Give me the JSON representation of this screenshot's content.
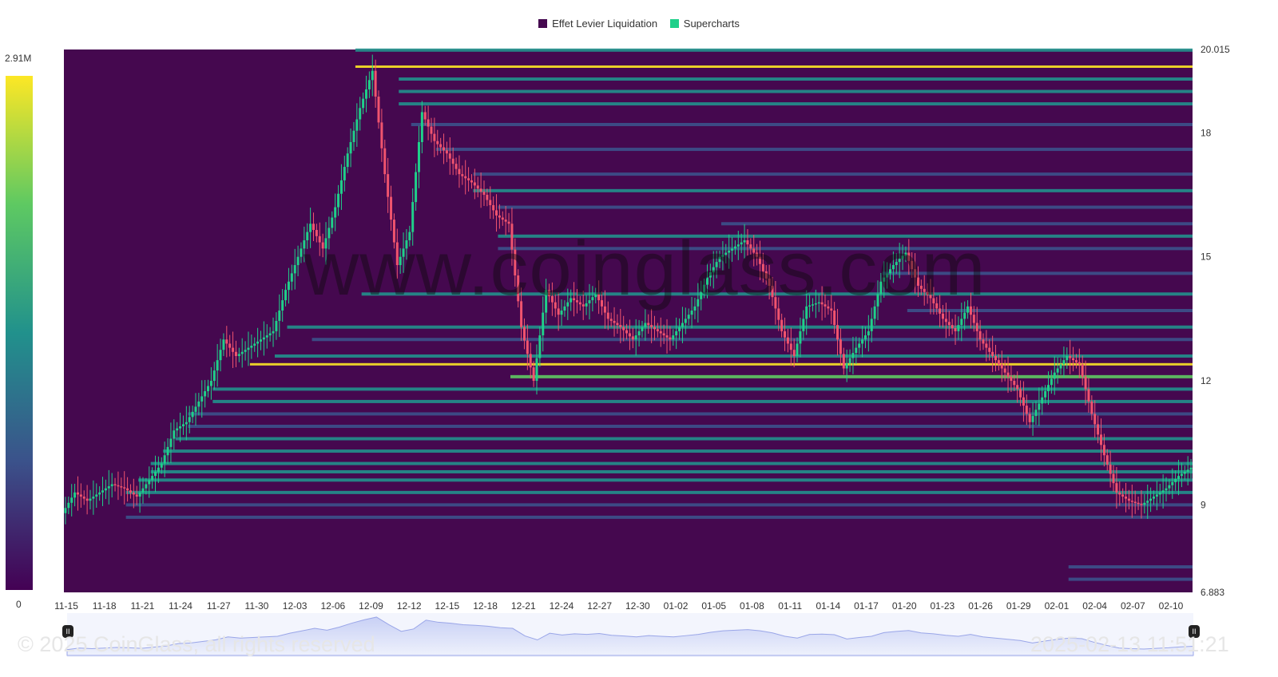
{
  "legend": {
    "items": [
      {
        "label": "Effet Levier Liquidation",
        "color": "#45084f"
      },
      {
        "label": "Supercharts",
        "color": "#1fd08a"
      }
    ]
  },
  "colorbar": {
    "max_label": "2.91M",
    "min_label": "0"
  },
  "watermark": "www.coinglass.com",
  "footer": {
    "copyright": "© 2025 CoinGlass, all rights reserved",
    "timestamp": "2025-02-13 11:51:21"
  },
  "slider": {
    "left_handle": "II",
    "right_handle": "II"
  },
  "colors": {
    "background": "#45084f",
    "low": "#3b528b",
    "mid": "#21918c",
    "high": "#5ec962",
    "max": "#fde725",
    "up": "#1fd08a",
    "down": "#f0546e"
  },
  "chart_data": {
    "type": "heatmap",
    "title": "",
    "xlabel": "",
    "ylabel": "",
    "x_ticks": [
      "11-15",
      "11-18",
      "11-21",
      "11-24",
      "11-27",
      "11-30",
      "12-03",
      "12-06",
      "12-09",
      "12-12",
      "12-15",
      "12-18",
      "12-21",
      "12-24",
      "12-27",
      "12-30",
      "01-02",
      "01-05",
      "01-08",
      "01-11",
      "01-14",
      "01-17",
      "01-20",
      "01-23",
      "01-26",
      "01-29",
      "02-01",
      "02-04",
      "02-07",
      "02-10"
    ],
    "y_ticks": [
      "20.015",
      "18",
      "15",
      "12",
      "9",
      "6.883"
    ],
    "ylim": [
      6.883,
      20.015
    ],
    "xlim": [
      0,
      91
    ],
    "price_series": [
      {
        "x": 0,
        "y": 8.8
      },
      {
        "x": 1,
        "y": 9.3
      },
      {
        "x": 2,
        "y": 9.1
      },
      {
        "x": 3,
        "y": 9.3
      },
      {
        "x": 4,
        "y": 9.5
      },
      {
        "x": 5,
        "y": 9.4
      },
      {
        "x": 6,
        "y": 9.2
      },
      {
        "x": 7,
        "y": 9.6
      },
      {
        "x": 8,
        "y": 10.0
      },
      {
        "x": 9,
        "y": 10.8
      },
      {
        "x": 10,
        "y": 11.0
      },
      {
        "x": 11,
        "y": 11.5
      },
      {
        "x": 12,
        "y": 12.0
      },
      {
        "x": 13,
        "y": 13.0
      },
      {
        "x": 14,
        "y": 12.6
      },
      {
        "x": 15,
        "y": 12.8
      },
      {
        "x": 16,
        "y": 13.0
      },
      {
        "x": 17,
        "y": 13.2
      },
      {
        "x": 18,
        "y": 14.2
      },
      {
        "x": 19,
        "y": 15.0
      },
      {
        "x": 20,
        "y": 15.8
      },
      {
        "x": 21,
        "y": 15.2
      },
      {
        "x": 22,
        "y": 16.2
      },
      {
        "x": 23,
        "y": 17.5
      },
      {
        "x": 24,
        "y": 18.6
      },
      {
        "x": 25,
        "y": 19.5
      },
      {
        "x": 26,
        "y": 17.0
      },
      {
        "x": 27,
        "y": 14.8
      },
      {
        "x": 28,
        "y": 15.6
      },
      {
        "x": 29,
        "y": 18.5
      },
      {
        "x": 30,
        "y": 17.8
      },
      {
        "x": 31,
        "y": 17.5
      },
      {
        "x": 32,
        "y": 17.0
      },
      {
        "x": 33,
        "y": 16.8
      },
      {
        "x": 34,
        "y": 16.5
      },
      {
        "x": 35,
        "y": 16.0
      },
      {
        "x": 36,
        "y": 15.8
      },
      {
        "x": 37,
        "y": 13.3
      },
      {
        "x": 38,
        "y": 12.0
      },
      {
        "x": 39,
        "y": 14.2
      },
      {
        "x": 40,
        "y": 13.6
      },
      {
        "x": 41,
        "y": 14.0
      },
      {
        "x": 42,
        "y": 13.8
      },
      {
        "x": 43,
        "y": 14.1
      },
      {
        "x": 44,
        "y": 13.5
      },
      {
        "x": 45,
        "y": 13.3
      },
      {
        "x": 46,
        "y": 13.0
      },
      {
        "x": 47,
        "y": 13.4
      },
      {
        "x": 48,
        "y": 13.2
      },
      {
        "x": 49,
        "y": 13.0
      },
      {
        "x": 50,
        "y": 13.4
      },
      {
        "x": 51,
        "y": 13.8
      },
      {
        "x": 52,
        "y": 14.5
      },
      {
        "x": 53,
        "y": 15.0
      },
      {
        "x": 54,
        "y": 15.2
      },
      {
        "x": 55,
        "y": 15.4
      },
      {
        "x": 56,
        "y": 15.0
      },
      {
        "x": 57,
        "y": 14.3
      },
      {
        "x": 58,
        "y": 13.2
      },
      {
        "x": 59,
        "y": 12.6
      },
      {
        "x": 60,
        "y": 13.8
      },
      {
        "x": 61,
        "y": 13.9
      },
      {
        "x": 62,
        "y": 13.7
      },
      {
        "x": 63,
        "y": 12.3
      },
      {
        "x": 64,
        "y": 12.8
      },
      {
        "x": 65,
        "y": 13.2
      },
      {
        "x": 66,
        "y": 14.4
      },
      {
        "x": 67,
        "y": 14.8
      },
      {
        "x": 68,
        "y": 15.1
      },
      {
        "x": 69,
        "y": 14.3
      },
      {
        "x": 70,
        "y": 14.0
      },
      {
        "x": 71,
        "y": 13.5
      },
      {
        "x": 72,
        "y": 13.2
      },
      {
        "x": 73,
        "y": 13.8
      },
      {
        "x": 74,
        "y": 13.0
      },
      {
        "x": 75,
        "y": 12.6
      },
      {
        "x": 76,
        "y": 12.2
      },
      {
        "x": 77,
        "y": 11.8
      },
      {
        "x": 78,
        "y": 11.0
      },
      {
        "x": 79,
        "y": 11.6
      },
      {
        "x": 80,
        "y": 12.2
      },
      {
        "x": 81,
        "y": 12.6
      },
      {
        "x": 82,
        "y": 12.4
      },
      {
        "x": 83,
        "y": 11.2
      },
      {
        "x": 84,
        "y": 10.2
      },
      {
        "x": 85,
        "y": 9.3
      },
      {
        "x": 86,
        "y": 9.1
      },
      {
        "x": 87,
        "y": 9.0
      },
      {
        "x": 88,
        "y": 9.2
      },
      {
        "x": 89,
        "y": 9.4
      },
      {
        "x": 90,
        "y": 9.7
      },
      {
        "x": 91,
        "y": 9.9
      }
    ],
    "liquidation_levels": [
      {
        "price": 20.0,
        "x_start": 23.5,
        "intensity": 0.5
      },
      {
        "price": 19.6,
        "x_start": 23.5,
        "intensity": 1.0
      },
      {
        "price": 19.3,
        "x_start": 27,
        "intensity": 0.45
      },
      {
        "price": 19.0,
        "x_start": 27,
        "intensity": 0.55
      },
      {
        "price": 18.7,
        "x_start": 27,
        "intensity": 0.5
      },
      {
        "price": 18.2,
        "x_start": 28,
        "intensity": 0.35
      },
      {
        "price": 17.6,
        "x_start": 30,
        "intensity": 0.3
      },
      {
        "price": 17.0,
        "x_start": 33,
        "intensity": 0.4
      },
      {
        "price": 16.6,
        "x_start": 33,
        "intensity": 0.45
      },
      {
        "price": 16.2,
        "x_start": 35,
        "intensity": 0.35
      },
      {
        "price": 15.8,
        "x_start": 53,
        "intensity": 0.35
      },
      {
        "price": 15.5,
        "x_start": 35,
        "intensity": 0.5
      },
      {
        "price": 15.2,
        "x_start": 35,
        "intensity": 0.3
      },
      {
        "price": 14.6,
        "x_start": 66,
        "intensity": 0.35
      },
      {
        "price": 14.1,
        "x_start": 24,
        "intensity": 0.5
      },
      {
        "price": 13.7,
        "x_start": 68,
        "intensity": 0.4
      },
      {
        "price": 13.3,
        "x_start": 18,
        "intensity": 0.45
      },
      {
        "price": 13.0,
        "x_start": 20,
        "intensity": 0.35
      },
      {
        "price": 12.6,
        "x_start": 17,
        "intensity": 0.5
      },
      {
        "price": 12.4,
        "x_start": 15,
        "intensity": 0.9
      },
      {
        "price": 12.1,
        "x_start": 36,
        "intensity": 0.75
      },
      {
        "price": 11.8,
        "x_start": 12,
        "intensity": 0.5
      },
      {
        "price": 11.5,
        "x_start": 12,
        "intensity": 0.45
      },
      {
        "price": 11.2,
        "x_start": 10,
        "intensity": 0.35
      },
      {
        "price": 10.9,
        "x_start": 10,
        "intensity": 0.4
      },
      {
        "price": 10.6,
        "x_start": 9,
        "intensity": 0.55
      },
      {
        "price": 10.3,
        "x_start": 8,
        "intensity": 0.5
      },
      {
        "price": 10.0,
        "x_start": 7,
        "intensity": 0.55
      },
      {
        "price": 9.8,
        "x_start": 7,
        "intensity": 0.6
      },
      {
        "price": 9.6,
        "x_start": 6,
        "intensity": 0.6
      },
      {
        "price": 9.3,
        "x_start": 5,
        "intensity": 0.45
      },
      {
        "price": 9.0,
        "x_start": 5,
        "intensity": 0.4
      },
      {
        "price": 8.7,
        "x_start": 5,
        "intensity": 0.3
      },
      {
        "price": 7.5,
        "x_start": 81,
        "intensity": 0.4
      },
      {
        "price": 7.2,
        "x_start": 81,
        "intensity": 0.35
      }
    ]
  }
}
